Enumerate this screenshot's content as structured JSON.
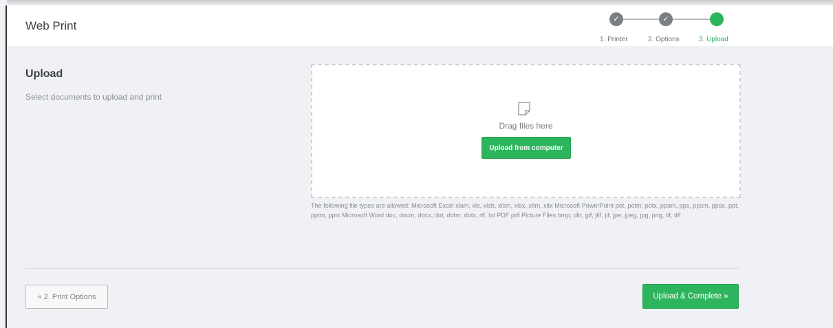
{
  "header": {
    "title": "Web Print"
  },
  "stepper": {
    "steps": [
      {
        "label": "1. Printer",
        "state": "complete",
        "icon": "check-icon"
      },
      {
        "label": "2. Options",
        "state": "complete",
        "icon": "check-icon"
      },
      {
        "label": "3. Upload",
        "state": "current",
        "icon": ""
      }
    ],
    "check_glyph": "✓",
    "colors": {
      "complete": "#7b7f85",
      "current": "#2db55d",
      "line": "#b9b9b9"
    }
  },
  "upload_section": {
    "title": "Upload",
    "subtitle": "Select documents to upload and print"
  },
  "dropzone": {
    "icon": "file-icon",
    "drag_text": "Drag files here",
    "upload_button_label": "Upload from computer"
  },
  "allowed_types_text": "The following file types are allowed: Microsoft Excel xlam, xls, xlsb, xlsm, xlsx, xltm, xltx Microsoft PowerPoint pot, potm, potx, ppam, pps, ppsm, ppsx, ppt, pptm, pptx Microsoft Word doc, docm, docx, dot, dotm, dotx, rtf, txt PDF pdf Picture Files bmp, dib, gif, jfif, jif, jpe, jpeg, jpg, png, tif, tiff",
  "footer": {
    "back_button_label": "« 2. Print Options",
    "complete_button_label": "Upload & Complete »"
  },
  "colors": {
    "accent": "#2db55d",
    "background": "#f0f1f4"
  }
}
